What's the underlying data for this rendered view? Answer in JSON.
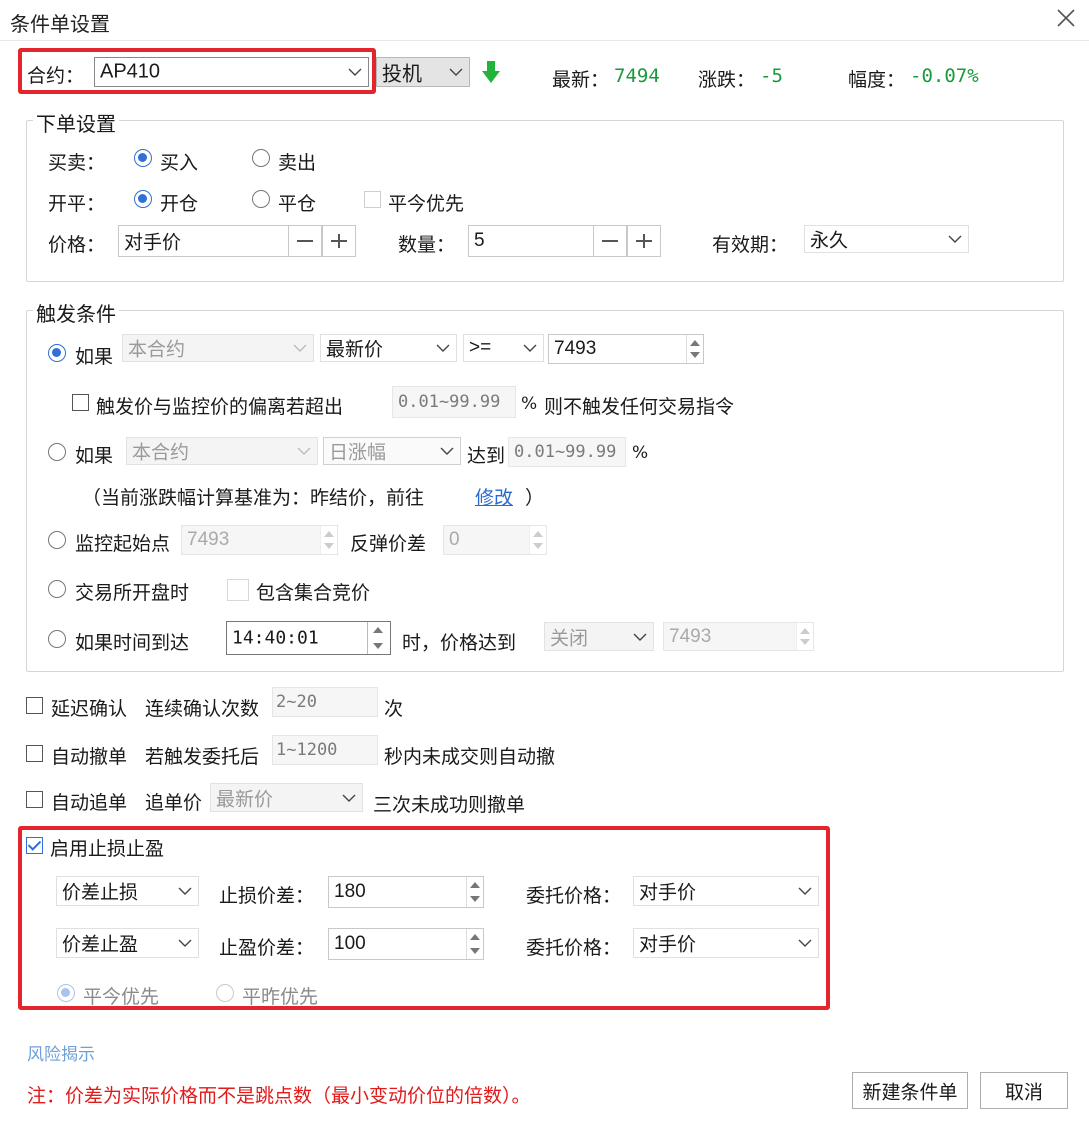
{
  "window": {
    "title": "条件单设置"
  },
  "contract": {
    "label": "合约：",
    "value": "AP410",
    "type_value": "投机",
    "latest_label": "最新：",
    "latest": "7494",
    "change_label": "涨跌：",
    "change": "-5",
    "pct_label": "幅度：",
    "pct": "-0.07%"
  },
  "order": {
    "title": "下单设置",
    "side_label": "买卖：",
    "buy": "买入",
    "sell": "卖出",
    "oc_label": "开平：",
    "open": "开仓",
    "close": "平仓",
    "close_today_first": "平今优先",
    "price_label": "价格：",
    "price_value": "对手价",
    "qty_label": "数量：",
    "qty_value": "5",
    "validity_label": "有效期：",
    "validity_value": "永久"
  },
  "trigger": {
    "title": "触发条件",
    "if_label": "如果",
    "c1_contract": "本合约",
    "c1_field": "最新价",
    "c1_op": ">=",
    "c1_value": "7493",
    "dev_text": "触发价与监控价的偏离若超出",
    "dev_range": "0.01~99.99",
    "dev_pct": "%",
    "dev_suffix": "则不触发任何交易指令",
    "c2_contract": "本合约",
    "c2_field": "日涨幅",
    "c2_reach": "达到",
    "c2_range": "0.01~99.99",
    "c2_pct": "%",
    "basis_prefix": "（当前涨跌幅计算基准为：昨结价，前往",
    "basis_link": "修改",
    "basis_suffix": "）",
    "monitor_label": "监控起始点",
    "monitor_value": "7493",
    "rebound_label": "反弹价差",
    "rebound_value": "0",
    "exchange_open": "交易所开盘时",
    "include_auction": "包含集合竞价",
    "time_label": "如果时间到达",
    "time_value": "14:40:01",
    "time_suffix": "时，价格达到",
    "time_cond": "关闭",
    "time_price": "7493"
  },
  "options": {
    "delay_label": "延迟确认",
    "delay_count_label": "连续确认次数",
    "delay_range": "2~20",
    "delay_unit": "次",
    "autocancel_label": "自动撤单",
    "autocancel_after": "若触发委托后",
    "autocancel_range": "1~1200",
    "autocancel_suffix": "秒内未成交则自动撤",
    "chase_label": "自动追单",
    "chase_price_label": "追单价",
    "chase_price": "最新价",
    "chase_suffix": "三次未成功则撤单"
  },
  "stop": {
    "enable_label": "启用止损止盈",
    "sl_type": "价差止损",
    "sl_label": "止损价差：",
    "sl_value": "180",
    "sl_price_label": "委托价格：",
    "sl_price": "对手价",
    "tp_type": "价差止盈",
    "tp_label": "止盈价差：",
    "tp_value": "100",
    "tp_price_label": "委托价格：",
    "tp_price": "对手价",
    "today_first": "平今优先",
    "yesterday_first": "平昨优先"
  },
  "footer": {
    "risk_link": "风险揭示",
    "note": "注：价差为实际价格而不是跳点数（最小变动价位的倍数）。",
    "new_button": "新建条件单",
    "cancel_button": "取消"
  },
  "colors": {
    "highlight": "#e3262b",
    "positive_down": "#1a9a3a",
    "accent": "#2f6fd6"
  },
  "icons": {
    "close": "close-icon",
    "arrow": "green-down-arrow-icon",
    "dropdown": "chevron-down-icon"
  }
}
